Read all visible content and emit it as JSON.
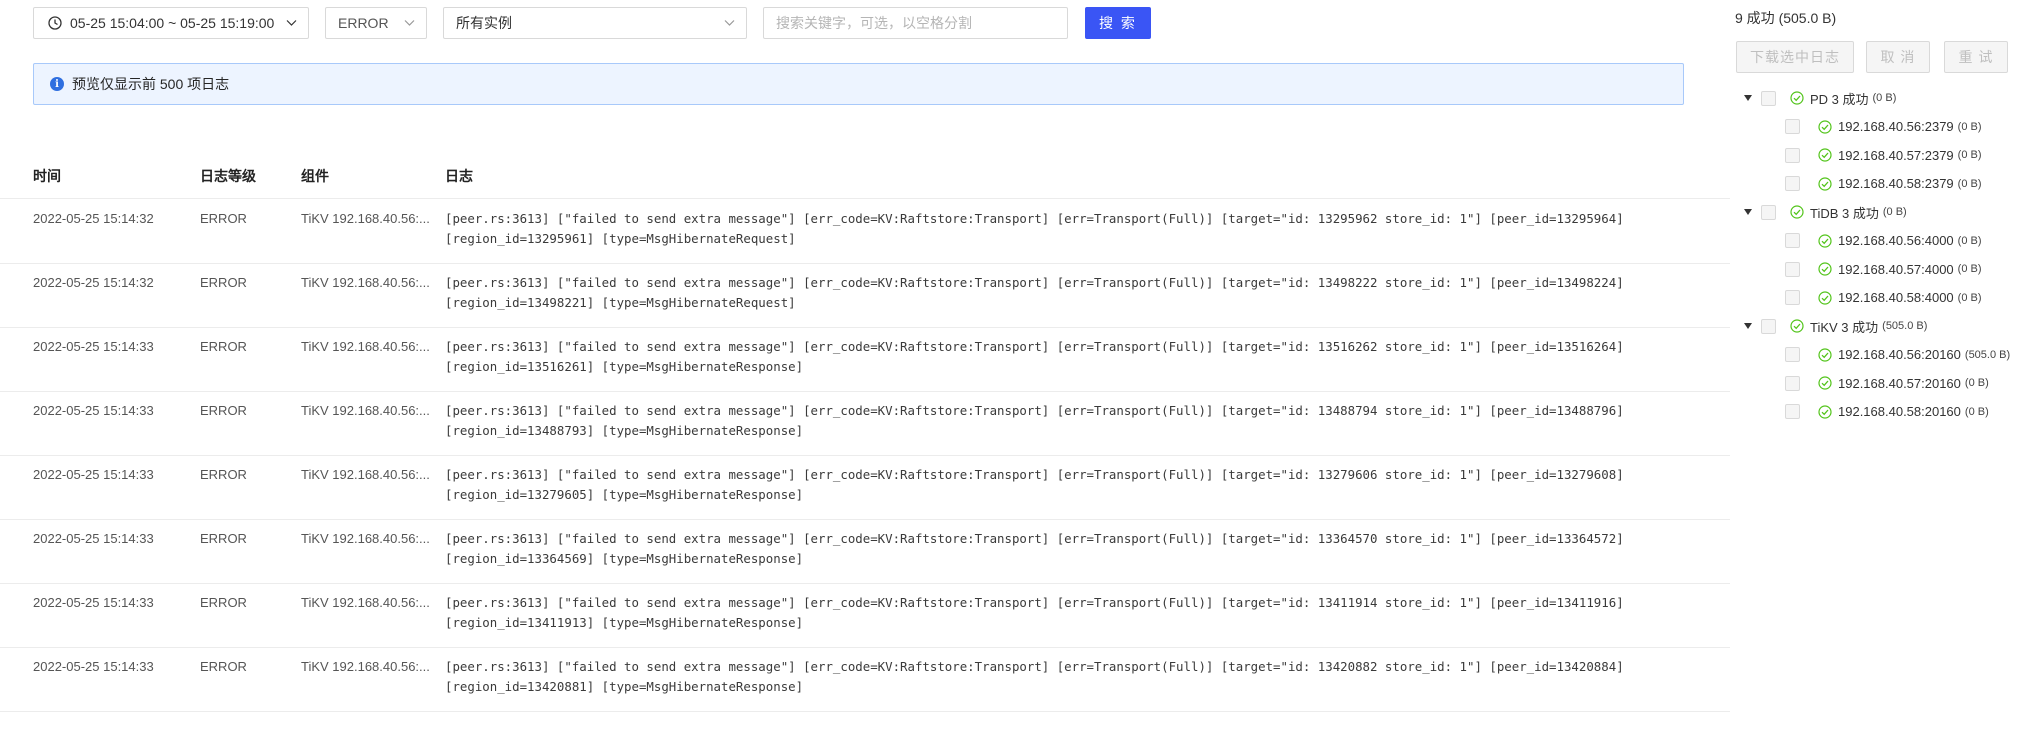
{
  "toolbar": {
    "time_range": "05-25 15:04:00 ~ 05-25 15:19:00",
    "level": "ERROR",
    "instances": "所有实例",
    "search_placeholder": "搜索关键字，可选，以空格分割",
    "search_button": "搜 索"
  },
  "alert": {
    "text": "预览仅显示前 500 项日志",
    "icon": "info-icon"
  },
  "table": {
    "columns": [
      "时间",
      "日志等级",
      "组件",
      "日志"
    ],
    "rows": [
      {
        "time": "2022-05-25 15:14:32",
        "level": "ERROR",
        "component": "TiKV 192.168.40.56:...",
        "message": "[peer.rs:3613] [\"failed to send extra message\"] [err_code=KV:Raftstore:Transport] [err=Transport(Full)] [target=\"id: 13295962 store_id: 1\"] [peer_id=13295964]\n[region_id=13295961] [type=MsgHibernateRequest]"
      },
      {
        "time": "2022-05-25 15:14:32",
        "level": "ERROR",
        "component": "TiKV 192.168.40.56:...",
        "message": "[peer.rs:3613] [\"failed to send extra message\"] [err_code=KV:Raftstore:Transport] [err=Transport(Full)] [target=\"id: 13498222 store_id: 1\"] [peer_id=13498224]\n[region_id=13498221] [type=MsgHibernateRequest]"
      },
      {
        "time": "2022-05-25 15:14:33",
        "level": "ERROR",
        "component": "TiKV 192.168.40.56:...",
        "message": "[peer.rs:3613] [\"failed to send extra message\"] [err_code=KV:Raftstore:Transport] [err=Transport(Full)] [target=\"id: 13516262 store_id: 1\"] [peer_id=13516264]\n[region_id=13516261] [type=MsgHibernateResponse]"
      },
      {
        "time": "2022-05-25 15:14:33",
        "level": "ERROR",
        "component": "TiKV 192.168.40.56:...",
        "message": "[peer.rs:3613] [\"failed to send extra message\"] [err_code=KV:Raftstore:Transport] [err=Transport(Full)] [target=\"id: 13488794 store_id: 1\"] [peer_id=13488796]\n[region_id=13488793] [type=MsgHibernateResponse]"
      },
      {
        "time": "2022-05-25 15:14:33",
        "level": "ERROR",
        "component": "TiKV 192.168.40.56:...",
        "message": "[peer.rs:3613] [\"failed to send extra message\"] [err_code=KV:Raftstore:Transport] [err=Transport(Full)] [target=\"id: 13279606 store_id: 1\"] [peer_id=13279608]\n[region_id=13279605] [type=MsgHibernateResponse]"
      },
      {
        "time": "2022-05-25 15:14:33",
        "level": "ERROR",
        "component": "TiKV 192.168.40.56:...",
        "message": "[peer.rs:3613] [\"failed to send extra message\"] [err_code=KV:Raftstore:Transport] [err=Transport(Full)] [target=\"id: 13364570 store_id: 1\"] [peer_id=13364572]\n[region_id=13364569] [type=MsgHibernateResponse]"
      },
      {
        "time": "2022-05-25 15:14:33",
        "level": "ERROR",
        "component": "TiKV 192.168.40.56:...",
        "message": "[peer.rs:3613] [\"failed to send extra message\"] [err_code=KV:Raftstore:Transport] [err=Transport(Full)] [target=\"id: 13411914 store_id: 1\"] [peer_id=13411916]\n[region_id=13411913] [type=MsgHibernateResponse]"
      },
      {
        "time": "2022-05-25 15:14:33",
        "level": "ERROR",
        "component": "TiKV 192.168.40.56:...",
        "message": "[peer.rs:3613] [\"failed to send extra message\"] [err_code=KV:Raftstore:Transport] [err=Transport(Full)] [target=\"id: 13420882 store_id: 1\"] [peer_id=13420884]\n[region_id=13420881] [type=MsgHibernateResponse]"
      }
    ]
  },
  "panel": {
    "summary": "9 成功 (505.0 B)",
    "buttons": {
      "download": "下载选中日志",
      "cancel": "取 消",
      "retry": "重 试"
    },
    "groups": [
      {
        "name": "PD 3 成功",
        "size": "(0 B)",
        "items": [
          {
            "addr": "192.168.40.56:2379",
            "size": "(0 B)"
          },
          {
            "addr": "192.168.40.57:2379",
            "size": "(0 B)"
          },
          {
            "addr": "192.168.40.58:2379",
            "size": "(0 B)"
          }
        ]
      },
      {
        "name": "TiDB 3 成功",
        "size": "(0 B)",
        "items": [
          {
            "addr": "192.168.40.56:4000",
            "size": "(0 B)"
          },
          {
            "addr": "192.168.40.57:4000",
            "size": "(0 B)"
          },
          {
            "addr": "192.168.40.58:4000",
            "size": "(0 B)"
          }
        ]
      },
      {
        "name": "TiKV 3 成功",
        "size": "(505.0 B)",
        "items": [
          {
            "addr": "192.168.40.56:20160",
            "size": "(505.0 B)"
          },
          {
            "addr": "192.168.40.57:20160",
            "size": "(0 B)"
          },
          {
            "addr": "192.168.40.58:20160",
            "size": "(0 B)"
          }
        ]
      }
    ]
  },
  "colors": {
    "primary": "#3a55f5",
    "success": "#52c41a",
    "info": "#2f6fe0"
  }
}
